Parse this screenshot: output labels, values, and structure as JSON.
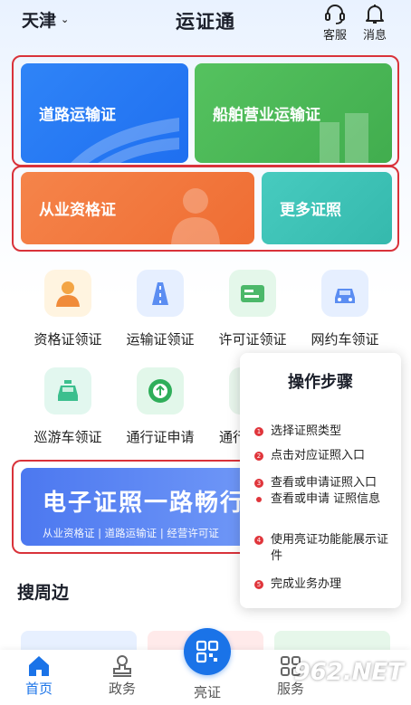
{
  "header": {
    "city": "天津",
    "title": "运证通",
    "service_label": "客服",
    "message_label": "消息"
  },
  "cards": {
    "road": "道路运输证",
    "ship": "船舶营业运输证",
    "qualification": "从业资格证",
    "more": "更多证照"
  },
  "grid": [
    {
      "label": "资格证领证",
      "icon": "person-icon"
    },
    {
      "label": "运输证领证",
      "icon": "road-icon"
    },
    {
      "label": "许可证领证",
      "icon": "license-card-icon"
    },
    {
      "label": "网约车领证",
      "icon": "car-icon"
    },
    {
      "label": "巡游车领证",
      "icon": "taxi-icon"
    },
    {
      "label": "通行证申请",
      "icon": "arrow-up-icon"
    },
    {
      "label": "通行",
      "icon": "pass-icon"
    }
  ],
  "banner": {
    "title": "电子证照一路畅行",
    "subtitle": "从业资格证 | 道路运输证 | 经营许可证"
  },
  "popup": {
    "title": "操作步骤",
    "steps": [
      "选择证照类型",
      "点击对应证照入口",
      "查看或申请证照入口",
      "查看或申请 证照信息",
      "使用亮证功能能展示证件",
      "完成业务办理"
    ],
    "numbers": [
      "1",
      "2",
      "3",
      "4",
      "5"
    ]
  },
  "nearby": {
    "title": "搜周边"
  },
  "nav": {
    "home": "首页",
    "government": "政务",
    "show_cert": "亮证",
    "service": "服务"
  },
  "watermark": "962.NET",
  "colors": {
    "primary": "#1a73e8",
    "road_card": "#2b7cf5",
    "ship_card": "#4cb85c",
    "qualification_card": "#f37a3f",
    "more_card": "#3fc4b8",
    "highlight_border": "#d9323a"
  }
}
